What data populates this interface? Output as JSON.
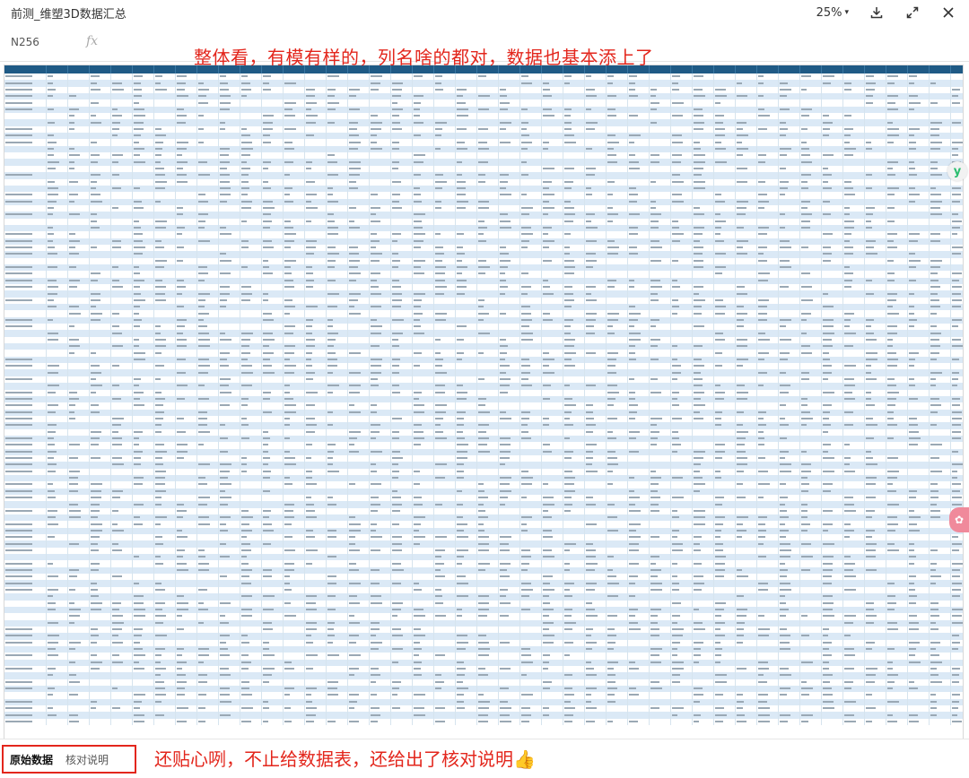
{
  "window": {
    "title": "前测_维塑3D数据汇总",
    "zoom": "25%",
    "icons": [
      "download-icon",
      "expand-icon",
      "close-icon"
    ]
  },
  "formula_bar": {
    "cell_ref": "N256",
    "fx_label": "fx",
    "value": ""
  },
  "annotations": {
    "top": "整体看，有模有样的，列名啥的都对，数据也基本添上了",
    "bottom": "还贴心咧，不止给数据表，还给出了核对说明👍"
  },
  "sheet_tabs": {
    "active": "原始数据",
    "other": "核对说明"
  },
  "colors": {
    "header_bg": "#1f5a85",
    "row_stripe": "#dbe9f6",
    "annotation_red": "#e3261c"
  },
  "grid": {
    "column_count": 49,
    "row_count": 99
  }
}
